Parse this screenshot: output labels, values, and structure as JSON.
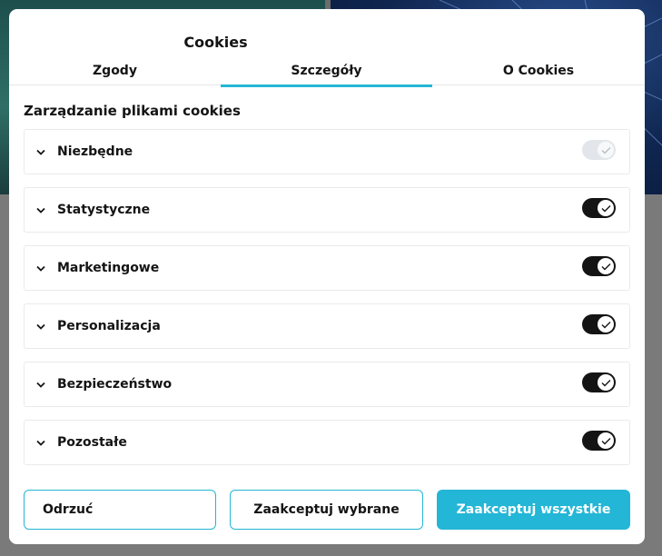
{
  "modal": {
    "title": "Cookies",
    "tabs": [
      {
        "label": "Zgody",
        "active": false
      },
      {
        "label": "Szczegóły",
        "active": true
      },
      {
        "label": "O Cookies",
        "active": false
      }
    ],
    "section_heading": "Zarządzanie plikami cookies",
    "categories": [
      {
        "label": "Niezbędne",
        "enabled": true,
        "disabled": true
      },
      {
        "label": "Statystyczne",
        "enabled": true,
        "disabled": false
      },
      {
        "label": "Marketingowe",
        "enabled": true,
        "disabled": false
      },
      {
        "label": "Personalizacja",
        "enabled": true,
        "disabled": false
      },
      {
        "label": "Bezpieczeństwo",
        "enabled": true,
        "disabled": false
      },
      {
        "label": "Pozostałe",
        "enabled": true,
        "disabled": false
      }
    ],
    "buttons": {
      "reject": "Odrzuć",
      "accept_selected": "Zaakceptuj wybrane",
      "accept_all": "Zaakceptuj wszystkie"
    }
  },
  "colors": {
    "accent": "#23b6d6",
    "toggle_on": "#141414",
    "toggle_disabled": "#e2e6ea",
    "overlay": "#6d6d6d"
  },
  "icons": {
    "expand": "chevron-down-icon",
    "toggle_state": "check-icon"
  }
}
